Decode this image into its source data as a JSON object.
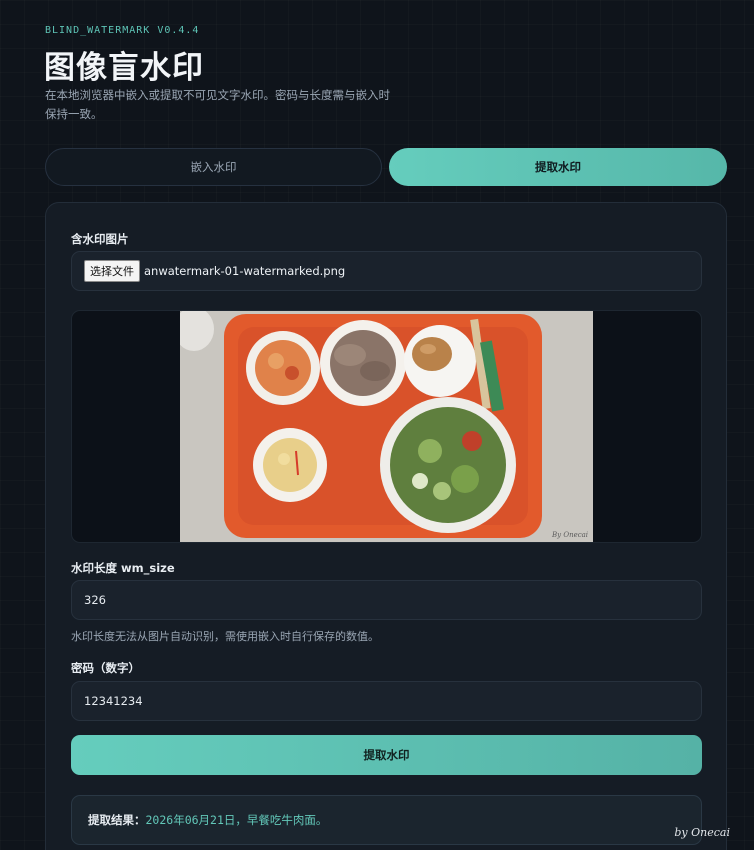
{
  "header": {
    "version": "BLIND_WATERMARK V0.4.4",
    "title": "图像盲水印",
    "subtitle": "在本地浏览器中嵌入或提取不可见文字水印。密码与长度需与嵌入时保持一致。"
  },
  "tabs": [
    {
      "label": "嵌入水印",
      "active": false
    },
    {
      "label": "提取水印",
      "active": true
    }
  ],
  "form": {
    "image_label": "含水印图片",
    "file_button": "选择文件",
    "file_name": "anwatermark-01-watermarked.png",
    "wm_size_label": "水印长度 wm_size",
    "wm_size_value": "326",
    "wm_size_hint": "水印长度无法从图片自动识别，需使用嵌入时自行保存的数值。",
    "password_label": "密码（数字）",
    "password_value": "12341234",
    "submit_label": "提取水印"
  },
  "result": {
    "label": "提取结果：",
    "value": "2026年06月21日，早餐吃牛肉面。"
  },
  "byline": "by Onecai",
  "colors": {
    "accent": "#62c7b8",
    "background": "#0f141b",
    "card": "#151c25"
  }
}
